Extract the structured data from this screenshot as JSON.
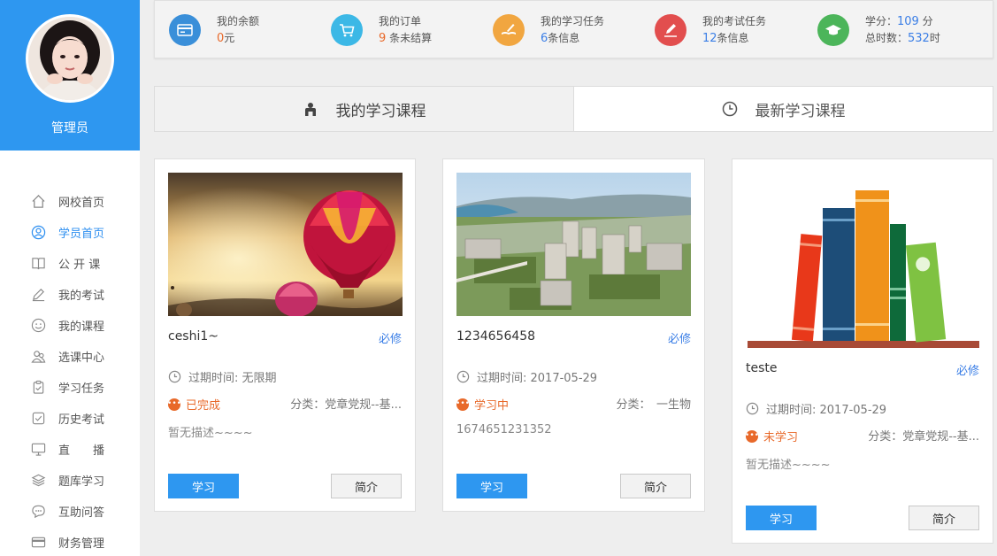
{
  "profile": {
    "name": "管理员"
  },
  "sidebar": {
    "items": [
      {
        "label": "网校首页",
        "icon": "home-icon"
      },
      {
        "label": "学员首页",
        "icon": "user-circle-icon",
        "active": true
      },
      {
        "label": "公 开 课",
        "icon": "book-open-icon"
      },
      {
        "label": "我的考试",
        "icon": "pencil-icon"
      },
      {
        "label": "我的课程",
        "icon": "smile-icon"
      },
      {
        "label": "选课中心",
        "icon": "users-icon"
      },
      {
        "label": "学习任务",
        "icon": "clipboard-check-icon"
      },
      {
        "label": "历史考试",
        "icon": "check-square-icon"
      },
      {
        "label": "直　　播",
        "icon": "monitor-icon"
      },
      {
        "label": "题库学习",
        "icon": "layers-icon"
      },
      {
        "label": "互助问答",
        "icon": "chat-icon"
      },
      {
        "label": "财务管理",
        "icon": "card-icon"
      }
    ]
  },
  "stats": {
    "balance": {
      "label": "我的余额",
      "value": "0",
      "unit": "元",
      "color": "#3a8fd9"
    },
    "orders": {
      "label": "我的订单",
      "value": "9",
      "unit": "条未结算",
      "color": "#3cb8e6"
    },
    "tasks": {
      "label": "我的学习任务",
      "value": "6",
      "unit": "条信息",
      "color": "#f1a640"
    },
    "exams": {
      "label": "我的考试任务",
      "value": "12",
      "unit": "条信息",
      "color": "#e24e4e"
    },
    "credits": {
      "credit_label": "学分：",
      "credit_value": "109",
      "credit_unit": "分",
      "hours_label": "总时数：",
      "hours_value": "532",
      "hours_unit": "时",
      "color": "#4cb55a"
    }
  },
  "tabs": [
    {
      "label": "我的学习课程"
    },
    {
      "label": "最新学习课程"
    }
  ],
  "courses": [
    {
      "title": "ceshi1~",
      "required": "必修",
      "expiry": "过期时间: 无限期",
      "status": "已完成",
      "category": "分类：党章党规--基...",
      "desc": "暂无描述~~~~",
      "study": "学习",
      "intro": "简介"
    },
    {
      "title": "1234656458",
      "required": "必修",
      "expiry": "过期时间: 2017-05-29",
      "status": "学习中",
      "category": "分类：　一生物",
      "desc": "1674651231352",
      "study": "学习",
      "intro": "简介"
    },
    {
      "title": "teste",
      "required": "必修",
      "expiry": "过期时间: 2017-05-29",
      "status": "未学习",
      "category": "分类：党章党规--基...",
      "desc": "暂无描述~~~~",
      "study": "学习",
      "intro": "简介"
    }
  ]
}
